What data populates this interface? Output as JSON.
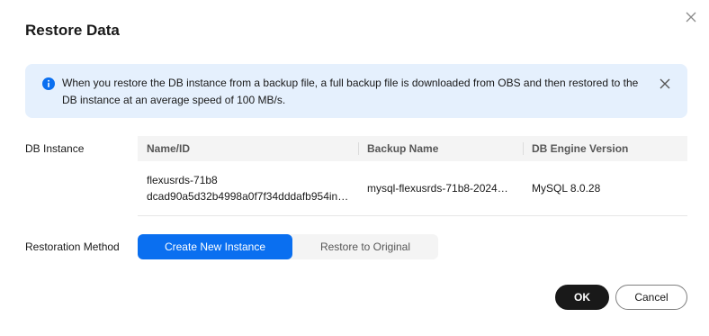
{
  "dialog": {
    "title": "Restore Data"
  },
  "alert": {
    "text": "When you restore the DB instance from a backup file, a full backup file is downloaded from OBS and then restored to the DB instance at an average speed of 100 MB/s.",
    "icon": "info-icon",
    "color": "#0a6ff0",
    "background": "#e5f0fd"
  },
  "db_instance": {
    "label": "DB Instance",
    "columns": [
      "Name/ID",
      "Backup Name",
      "DB Engine Version"
    ],
    "row": {
      "name": "flexusrds-71b8",
      "id": "dcad90a5d32b4998a0f7f34dddafb954in…",
      "backup_name": "mysql-flexusrds-71b8-2024…",
      "engine_version": "MySQL 8.0.28"
    }
  },
  "restoration": {
    "label": "Restoration Method",
    "options": [
      "Create New Instance",
      "Restore to Original"
    ],
    "selected": "Create New Instance"
  },
  "footer": {
    "ok_label": "OK",
    "cancel_label": "Cancel"
  },
  "colors": {
    "primary": "#0a6ff0",
    "ok_button": "#191919"
  }
}
